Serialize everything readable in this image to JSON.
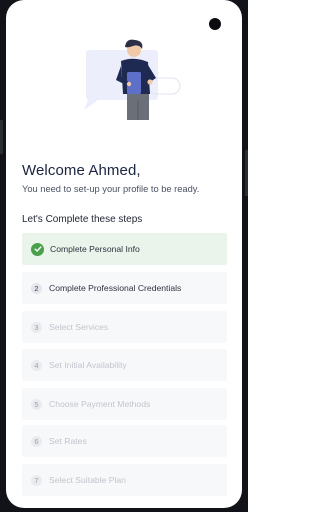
{
  "welcome": {
    "title": "Welcome Ahmed,",
    "subtitle": "You need to set-up your profile to be ready."
  },
  "steps_heading": "Let's Complete these steps",
  "steps": [
    {
      "number": "1",
      "label": "Complete Personal Info",
      "state": "completed"
    },
    {
      "number": "2",
      "label": "Complete Professional Credentials",
      "state": "active"
    },
    {
      "number": "3",
      "label": "Select Services",
      "state": "disabled"
    },
    {
      "number": "4",
      "label": "Set Initial Availability",
      "state": "disabled"
    },
    {
      "number": "5",
      "label": "Choose Payment Methods",
      "state": "disabled"
    },
    {
      "number": "6",
      "label": "Set Rates",
      "state": "disabled"
    },
    {
      "number": "7",
      "label": "Select Suitable Plan",
      "state": "disabled"
    }
  ],
  "colors": {
    "completed": "#4aa04a",
    "title": "#1b2440",
    "hero_accent": "#1f2a52"
  },
  "icons": {
    "completed_step": "check-circle-icon",
    "hero": "person-with-tablet-illustration"
  }
}
